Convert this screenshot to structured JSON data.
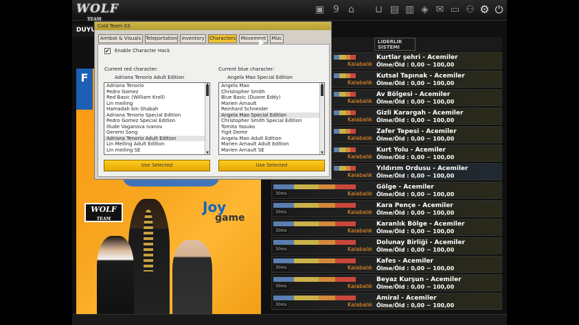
{
  "topbar": {
    "logo_main": "WOLF",
    "logo_sub": "TEAM",
    "icons": [
      "image-icon",
      "number-icon",
      "ranking-icon",
      "cart-icon",
      "bag-icon",
      "book-icon",
      "gift-icon",
      "mail-icon",
      "chat-icon",
      "friends-icon",
      "gear-icon",
      "power-icon"
    ]
  },
  "left_panel": {
    "announcements_label": "DUYU",
    "banner": {
      "fx_text": "F",
      "promo_text": "",
      "wolf_logo_main": "WOLF",
      "wolf_logo_sub": "TEAM",
      "joy_brand": "Joy",
      "joy_brand_sub": "game"
    }
  },
  "room_list": {
    "header_logo": "LIDERLIK SISTEMI",
    "rooms": [
      {
        "name": "Kurtlar şehri - Acemiler",
        "stats": "Ölme/Öld : 0,00 ~ 100,00",
        "crowd": "Kalabalık",
        "ms": ""
      },
      {
        "name": "Kutsal Tapınak - Acemiler",
        "stats": "Ölme/Öld : 0,00 ~ 100,00",
        "crowd": "Kalabalık",
        "ms": ""
      },
      {
        "name": "Av Bölgesi - Acemiler",
        "stats": "Ölme/Öld : 0,00 ~ 100,00",
        "crowd": "Kalabalık",
        "ms": ""
      },
      {
        "name": "Gizli Karargah - Acemiler",
        "stats": "Ölme/Öld : 0,00 ~ 100,00",
        "crowd": "Kalabalık",
        "ms": ""
      },
      {
        "name": "Zafer Tepesi - Acemiler",
        "stats": "Ölme/Öld : 0,00 ~ 100,00",
        "crowd": "Kalabalık",
        "ms": ""
      },
      {
        "name": "Kurt Yolu - Acemiler",
        "stats": "Ölme/Öld : 0,00 ~ 100,00",
        "crowd": "Kalabalık",
        "ms": ""
      },
      {
        "name": "Yıldırım Ordusu - Acemiler",
        "stats": "Ölme/Öld : 0,00 ~ 100,00",
        "crowd": "Kalabalık",
        "ms": ""
      },
      {
        "name": "Gölge - Acemiler",
        "stats": "Ölme/Öld : 0,00 ~ 100,00",
        "crowd": "Kalabalık",
        "ms": "30ms"
      },
      {
        "name": "Kara Pençe - Acemiler",
        "stats": "Ölme/Öld : 0,00 ~ 100,00",
        "crowd": "Kalabalık",
        "ms": "30ms"
      },
      {
        "name": "Karanlık Bölge - Acemiler",
        "stats": "Ölme/Öld : 0,00 ~ 100,00",
        "crowd": "Kalabalık",
        "ms": "30ms"
      },
      {
        "name": "Dolunay Birliği - Acemiler",
        "stats": "Ölme/Öld : 0,00 ~ 100,00",
        "crowd": "Kalabalık",
        "ms": "30ms"
      },
      {
        "name": "Kafes - Acemiler",
        "stats": "Ölme/Öld : 0,00 ~ 100,00",
        "crowd": "Kalabalık",
        "ms": "30ms"
      },
      {
        "name": "Beyaz Kurşun - Acemiler",
        "stats": "Ölme/Öld : 0,00 ~ 100,00",
        "crowd": "Kalabalık",
        "ms": "30ms"
      },
      {
        "name": "Amiral - Acemiler",
        "stats": "Ölme/Öld : 0,00 ~ 100,00",
        "crowd": "Kalabalık",
        "ms": "30ms"
      }
    ]
  },
  "dialog": {
    "title": "Cold Team 03",
    "tabs": [
      {
        "label": "Aimbot & Visuals",
        "active": false
      },
      {
        "label": "Teleportation",
        "active": false
      },
      {
        "label": "Inventory",
        "active": false
      },
      {
        "label": "Characters",
        "active": true
      },
      {
        "label": "Movement",
        "active": false
      },
      {
        "label": "Mizc",
        "active": false
      }
    ],
    "enable_checked": true,
    "enable_label": "Enable Character Hack",
    "red": {
      "label": "Current red character:",
      "value": "Adriana Tenorio Adult Edition",
      "items": [
        "Adriana Tenorio",
        "Pedro Gomez",
        "Red Basic (William Kroll)",
        "Lin meiling",
        "Hamadah bin Shabah",
        "Adriana Tenorio Special Edition",
        "Pedro Gomez Special Edition",
        "Illude Vaganova Ivanov",
        "Geremi Song",
        "Adriana Tenorio Adult Edition",
        "Lin Meiling Adult Edition",
        "Lin meiling SE"
      ],
      "selected_index": 9,
      "button": "Use Selected"
    },
    "blue": {
      "label": "Current blue character:",
      "value": "Angela Mao Special Edition",
      "items": [
        "Angela Mao",
        "Christopher Smith",
        "Blue Basic (Duane Eddy)",
        "Marien Arnault",
        "Reinhard Schneider",
        "Angela Mao Special Edition",
        "Christopher Smith Special Edition",
        "Tomita Yasuko",
        "Yigit Demir",
        "Angela Mao Adult Edition",
        "Marien Arnault Adult Edition",
        "Marien Arnault SE"
      ],
      "selected_index": 5,
      "button": "Use Selected"
    }
  }
}
